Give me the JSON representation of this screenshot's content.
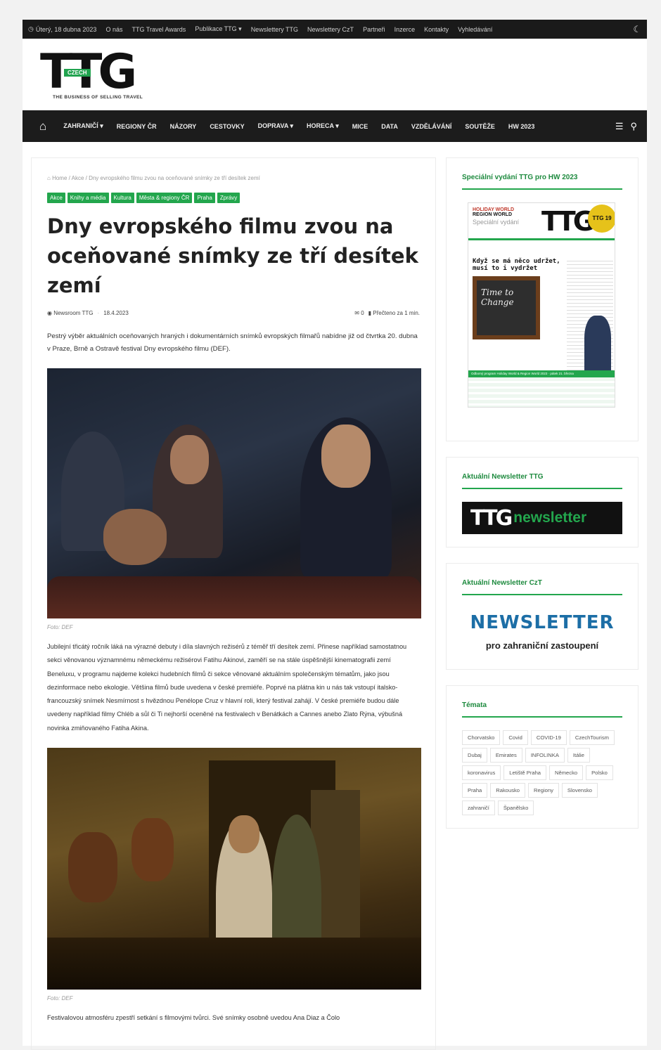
{
  "topbar": {
    "date": "Úterý, 18 dubna 2023",
    "links": [
      "O nás",
      "TTG Travel Awards",
      "Publikace TTG ▾",
      "Newslettery TTG",
      "Newslettery CzT",
      "Partneři",
      "Inzerce",
      "Kontakty",
      "Vyhledávání"
    ]
  },
  "logo": {
    "text": "TTG",
    "badge": "CZECH",
    "tagline": "THE BUSINESS OF SELLING TRAVEL"
  },
  "nav": {
    "items": [
      "ZAHRANIČÍ ▾",
      "REGIONY ČR",
      "NÁZORY",
      "CESTOVKY",
      "DOPRAVA ▾",
      "HORECA ▾",
      "MICE",
      "DATA",
      "VZDĚLÁVÁNÍ",
      "SOUTĚŽE",
      "HW 2023"
    ]
  },
  "article": {
    "breadcrumb": "Home / Akce / Dny evropského filmu zvou na oceňované snímky ze tří desítek zemí",
    "tags": [
      "Akce",
      "Knihy a média",
      "Kultura",
      "Města & regiony ČR",
      "Praha",
      "Zprávy"
    ],
    "title": "Dny evropského filmu zvou na oceňované snímky ze tří desítek zemí",
    "author": "Newsroom TTG",
    "date": "18.4.2023",
    "comments": "0",
    "read_time": "Přečteno za 1 min.",
    "lead": "Pestrý výběr aktuálních oceňovaných hraných i dokumentárních snímků evropských filmařů nabídne již od čtvrtka 20. dubna v Praze, Brně a Ostravě festival Dny evropského filmu (DEF).",
    "caption1": "Foto: DEF",
    "body": "Jubilejní třicátý ročník láká na výrazné debuty i díla slavných režisérů z téměř tří desítek zemí. Přinese například samostatnou sekci věnovanou významnému německému režisérovi Fatihu Akinovi, zaměří se na stále úspěšnější kinematografii zemí Beneluxu, v programu najdeme kolekci hudebních filmů či sekce věnované aktuálním společenským tématům, jako jsou dezinformace nebo ekologie. Většina filmů bude uvedena v české premiéře. Poprvé na plátna kin u nás tak vstoupí italsko-francouzský snímek Nesmírnost s hvězdnou Penélope Cruz v hlavní roli, který festival zahájí. V české premiéře budou dále uvedeny například filmy Chléb a sůl či Ti nejhorší oceněné na festivalech v Benátkách a Cannes anebo Zlato Rýna, výbušná novinka zmiňovaného Fatiha Akina.",
    "caption2": "Foto: DEF",
    "body2": "Festivalovou atmosféru zpestří setkání s filmovými tvůrci. Své snímky osobně uvedou Ana Diaz a Čolo"
  },
  "sidebar": {
    "w1_title": "Speciální vydání TTG pro HW 2023",
    "cover": {
      "headline": "Když se má něco udržet, musí to i vydržet",
      "chalk": "Time to Change",
      "hw1": "HOLIDAY WORLD",
      "hw2": "REGION WORLD",
      "special": "Speciální vydání",
      "badge": "TTG 19",
      "table_title": "Odborný program Holiday World & Region World 2023 · pátek 21. března"
    },
    "w2_title": "Aktuální Newsletter TTG",
    "banner_a": "TTG",
    "banner_b": "newsletter",
    "w3_title": "Aktuální Newsletter CzT",
    "czt_big": "NEWSLETTER",
    "czt_sub": "pro zahraniční zastoupení",
    "w4_title": "Témata",
    "topics": [
      "Chorvatsko",
      "Covid",
      "COVID-19",
      "CzechTourism",
      "Dubaj",
      "Emirates",
      "INFOLINKA",
      "Itálie",
      "koronavirus",
      "Letiště Praha",
      "Německo",
      "Polsko",
      "Praha",
      "Rakousko",
      "Regiony",
      "Slovensko",
      "zahraničí",
      "Španělsko"
    ]
  },
  "colors": {
    "accent": "#23a64d",
    "dark": "#1c1c1c",
    "czt_blue": "#1c6ea6"
  },
  "icons": [
    "clock-icon",
    "moon-icon",
    "home-icon",
    "menu-icon",
    "search-icon",
    "user-icon",
    "comment-icon",
    "bookmark-icon"
  ]
}
